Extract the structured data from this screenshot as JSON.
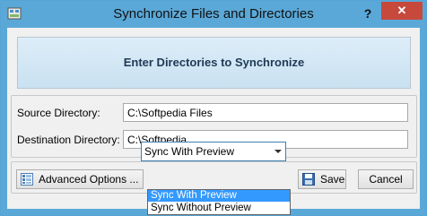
{
  "window": {
    "title": "Synchronize Files and Directories",
    "help_label": "?",
    "close_label": "✕"
  },
  "banner": {
    "text": "Enter Directories to Synchronize"
  },
  "form": {
    "source_label": "Source Directory:",
    "source_value": "C:\\Softpedia Files",
    "destination_label": "Destination Directory:",
    "destination_value": "C:\\Softpedia"
  },
  "toolbar": {
    "advanced_label": "Advanced Options ...",
    "mode_selected": "Sync With Preview",
    "save_label": "Save",
    "cancel_label": "Cancel"
  },
  "dropdown": {
    "options": [
      "Sync With Preview",
      "Sync Without Preview"
    ],
    "highlighted_index": 0
  },
  "colors": {
    "titlebar": "#5aa8d8",
    "close_button": "#c7493c",
    "selection": "#3399ff"
  }
}
